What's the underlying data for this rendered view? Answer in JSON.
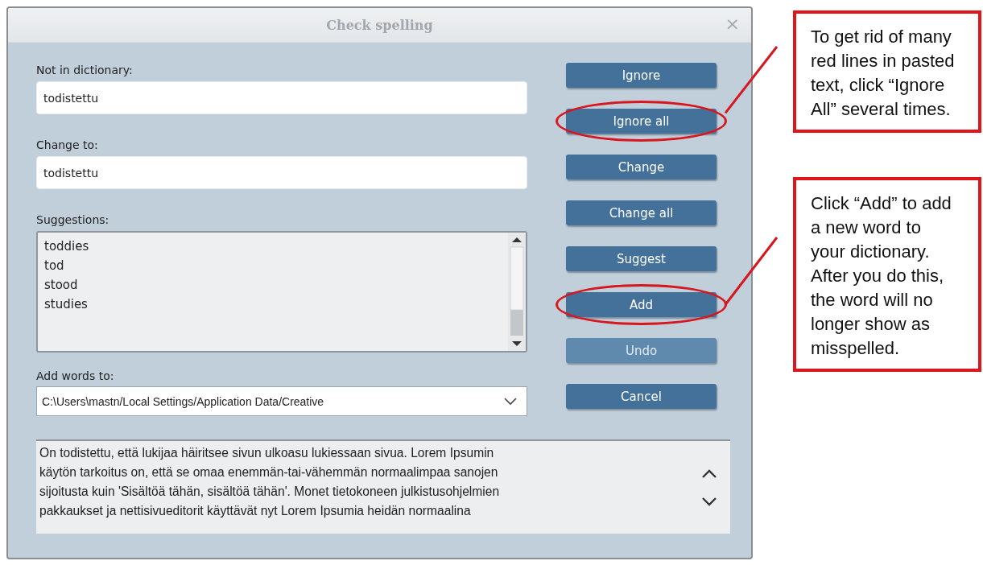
{
  "window": {
    "title": "Check spelling",
    "close": "×"
  },
  "not_in_dictionary": {
    "label": "Not in dictionary:",
    "value": "todistettu"
  },
  "change_to": {
    "label": "Change to:",
    "value": "todistettu"
  },
  "suggestions": {
    "label": "Suggestions:",
    "items": [
      {
        "text": "toddies",
        "selected": false
      },
      {
        "text": "tod",
        "selected": false
      },
      {
        "text": "stood",
        "selected": false
      },
      {
        "text": "studies",
        "selected": false
      }
    ]
  },
  "add_words_to": {
    "label": "Add words to:",
    "value": "C:\\Users\\mastn/Local Settings/Application Data/Creative"
  },
  "buttons": [
    {
      "label": "Ignore",
      "disabled": false,
      "circled": false
    },
    {
      "label": "Ignore all",
      "disabled": false,
      "circled": true
    },
    {
      "label": "Change",
      "disabled": false,
      "circled": false
    },
    {
      "label": "Change all",
      "disabled": false,
      "circled": false
    },
    {
      "label": "Suggest",
      "disabled": false,
      "circled": false
    },
    {
      "label": "Add",
      "disabled": false,
      "circled": true
    },
    {
      "label": "Undo",
      "disabled": true,
      "circled": false
    },
    {
      "label": "Cancel",
      "disabled": false,
      "circled": false
    }
  ],
  "context": {
    "lines": [
      "On todistettu, että lukijaa häiritsee sivun ulkoasu lukiessaan sivua. Lorem Ipsumin",
      "käytön tarkoitus on, että se omaa enemmän-tai-vähemmän normaalimpaa sanojen",
      "sijoitusta kuin 'Sisältöä tähän, sisältöä tähän'. Monet tietokoneen julkistusohjelmien",
      "pakkaukset ja nettisivueditorit käyttävät nyt Lorem Ipsumia heidän normaalina"
    ]
  },
  "callouts": [
    {
      "text": "To get rid of many red lines in pasted text, click “Ignore All” several times."
    },
    {
      "text": "Click “Add” to add a new word to your dictionary. After you do this, the word will no longer show as misspelled."
    }
  ]
}
